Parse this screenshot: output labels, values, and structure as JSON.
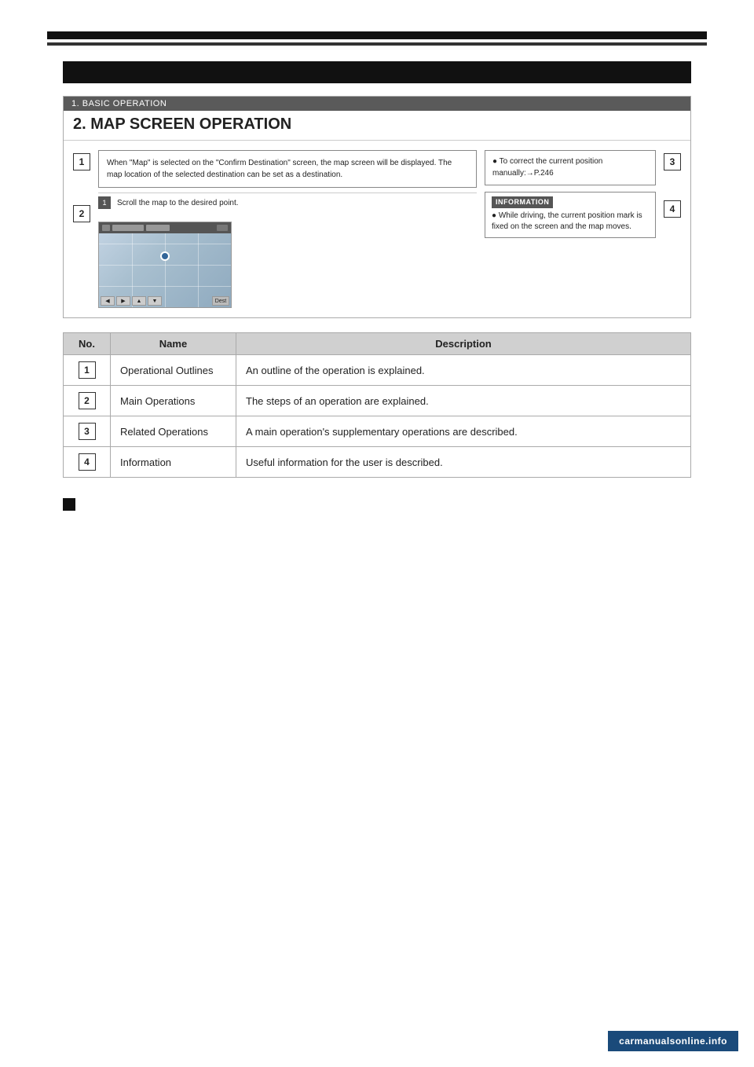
{
  "page": {
    "background": "#ffffff"
  },
  "header_bar": {
    "label": ""
  },
  "section_bar": {
    "text": ""
  },
  "diagram": {
    "header": "1. BASIC OPERATION",
    "title": "2. MAP SCREEN OPERATION",
    "box1_text": "When \"Map\" is selected on the \"Confirm Destination\" screen, the map screen will be displayed. The map location of the selected destination can be set as a destination.",
    "step1_text": "Scroll the map to the desired point.",
    "right_box3_text": "● To correct the current position manually:→P.246",
    "info_label": "INFORMATION",
    "info_text": "● While driving, the current position mark is fixed on the screen and the map moves.",
    "num1": "1",
    "num2": "2",
    "num3": "3",
    "num4": "4"
  },
  "table": {
    "headers": [
      "No.",
      "Name",
      "Description"
    ],
    "rows": [
      {
        "num": "1",
        "name": "Operational Outlines",
        "description": "An outline of the operation is explained."
      },
      {
        "num": "2",
        "name": "Main Operations",
        "description": "The steps of an operation are explained."
      },
      {
        "num": "3",
        "name": "Related Operations",
        "description": "A main operation's supplementary operations are described."
      },
      {
        "num": "4",
        "name": "Information",
        "description": "Useful information for the user is described."
      }
    ]
  },
  "watermark": "carmanualsonline.info"
}
